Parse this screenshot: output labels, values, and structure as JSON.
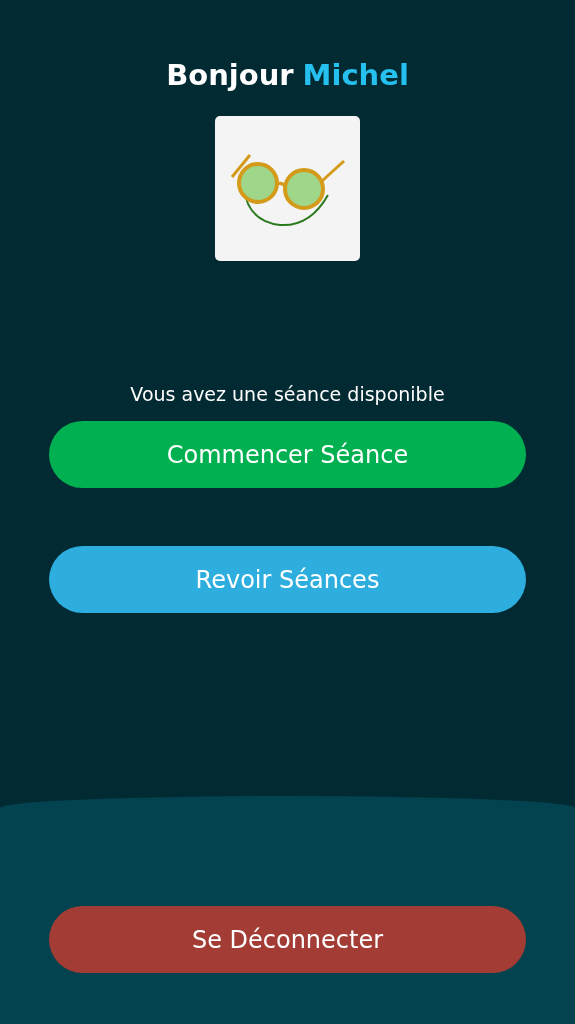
{
  "greeting": {
    "text": "Bonjour",
    "name": "Michel"
  },
  "avatar": {
    "kind": "glasses"
  },
  "message": "Vous avez une séance disponible",
  "actions": [
    {
      "label": "Commencer Séance",
      "kind": "primary"
    },
    {
      "label": "Revoir Séances",
      "kind": "secondary"
    }
  ],
  "logout": {
    "label": "Se Déconnecter",
    "kind": "danger"
  }
}
